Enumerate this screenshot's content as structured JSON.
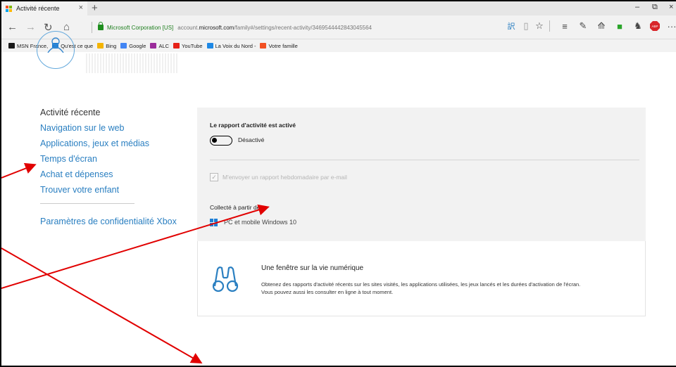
{
  "tab": {
    "title": "Activité récente",
    "close_glyph": "×",
    "new_tab_glyph": "+",
    "logo_colors": [
      "#f25022",
      "#7fba00",
      "#00a4ef",
      "#ffb900"
    ]
  },
  "window_controls": {
    "minimize": "–",
    "restore": "⧉",
    "close": "×"
  },
  "nav": {
    "back": "←",
    "forward": "→",
    "refresh": "↻",
    "home": "⌂"
  },
  "address": {
    "cert": "Microsoft Corporation [US]",
    "url_prefix": "account.",
    "url_host": "microsoft.com",
    "url_path": "/family#/settings/recent-activity/3469544442843045564"
  },
  "toolbar_icons": [
    "translate-icon",
    "reading-view-icon",
    "favorite-star-icon",
    "hub-icon",
    "web-note-icon",
    "share-icon",
    "extension-icon",
    "extension-icon-2",
    "adblock-icon",
    "more-icon"
  ],
  "favorites": [
    {
      "label": "MSN France,",
      "color": "#1a1a1a"
    },
    {
      "label": "Qu'est ce que",
      "color": "#1e7fd6"
    },
    {
      "label": "Bing",
      "color": "#f4b400"
    },
    {
      "label": "Google",
      "color": "#4285f4"
    },
    {
      "label": "ALC",
      "color": "#9b2c9b"
    },
    {
      "label": "YouTube",
      "color": "#e62117"
    },
    {
      "label": "La Voix du Nord -",
      "color": "#1e88e5"
    },
    {
      "label": "Votre famille",
      "color": "#f25022"
    }
  ],
  "user": {
    "name": ""
  },
  "sidebar": {
    "active": "Activité récente",
    "items": [
      "Navigation sur le web",
      "Applications, jeux et médias",
      "Temps d'écran",
      "Achat et dépenses",
      "Trouver votre enfant"
    ],
    "footer_link": "Paramètres de confidentialité Xbox"
  },
  "report": {
    "title": "Le rapport d'activité est activé",
    "toggle_label": "Désactivé",
    "toggle_on": false,
    "email_checkbox_label": "M'envoyer un rapport hebdomadaire par e-mail",
    "collected_from_title": "Collecté à partir de",
    "collected_from_source": "PC et mobile Windows 10"
  },
  "info_card": {
    "title": "Une fenêtre sur la vie numérique",
    "text": "Obtenez des rapports d'activité récents sur les sites visités, les applications utilisées, les jeux lancés et les durées d'activation de l'écran. Vous pouvez aussi les consulter en ligne à tout moment."
  },
  "colors": {
    "link": "#2a7fc1",
    "annotation_arrow": "#e10000",
    "panel_bg": "#f2f2f2"
  }
}
